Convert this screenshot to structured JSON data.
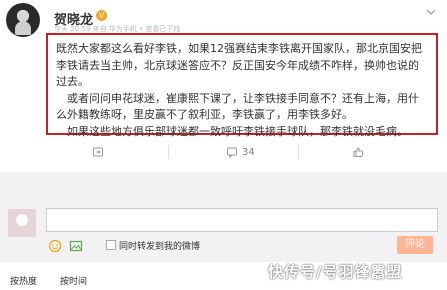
{
  "post": {
    "author": "贺晓龙",
    "verified_badge": "V",
    "meta": "今天 20:59 来自 华为手机 • 查看已下线",
    "paragraphs": [
      "既然大家都这么看好李铁，如果12强赛结束李铁离开国家队，那北京国安把李铁请去当主帅，北京球迷答应不？反正国安今年成绩不咋样，换帅也说的过去。",
      "或者问问申花球迷，崔康熙下课了，让李铁接手同意不？还有上海，用什么外籍教练呀，里皮赢不了叙利亚，李铁赢了，用李铁多好。",
      "如果这些地方俱乐部球迷都一致呼吁李铁接手球队，那李铁就没毛病。"
    ]
  },
  "actions": {
    "forward": "",
    "comments": "34",
    "likes": ""
  },
  "comment_box": {
    "placeholder": "",
    "repost_label": "同时转发到我的微博",
    "submit_label": "评论"
  },
  "tabs": {
    "hot": "按热度",
    "time": "按时间"
  },
  "watermark": "快传号/号羽锋嚣盟",
  "colors": {
    "highlight_border": "#c8202b",
    "submit_button": "#ffb594",
    "verified_badge": "#f5a623"
  },
  "icons": [
    "more-icon",
    "forward-icon",
    "comment-icon",
    "like-icon",
    "emoji-icon",
    "image-icon"
  ]
}
